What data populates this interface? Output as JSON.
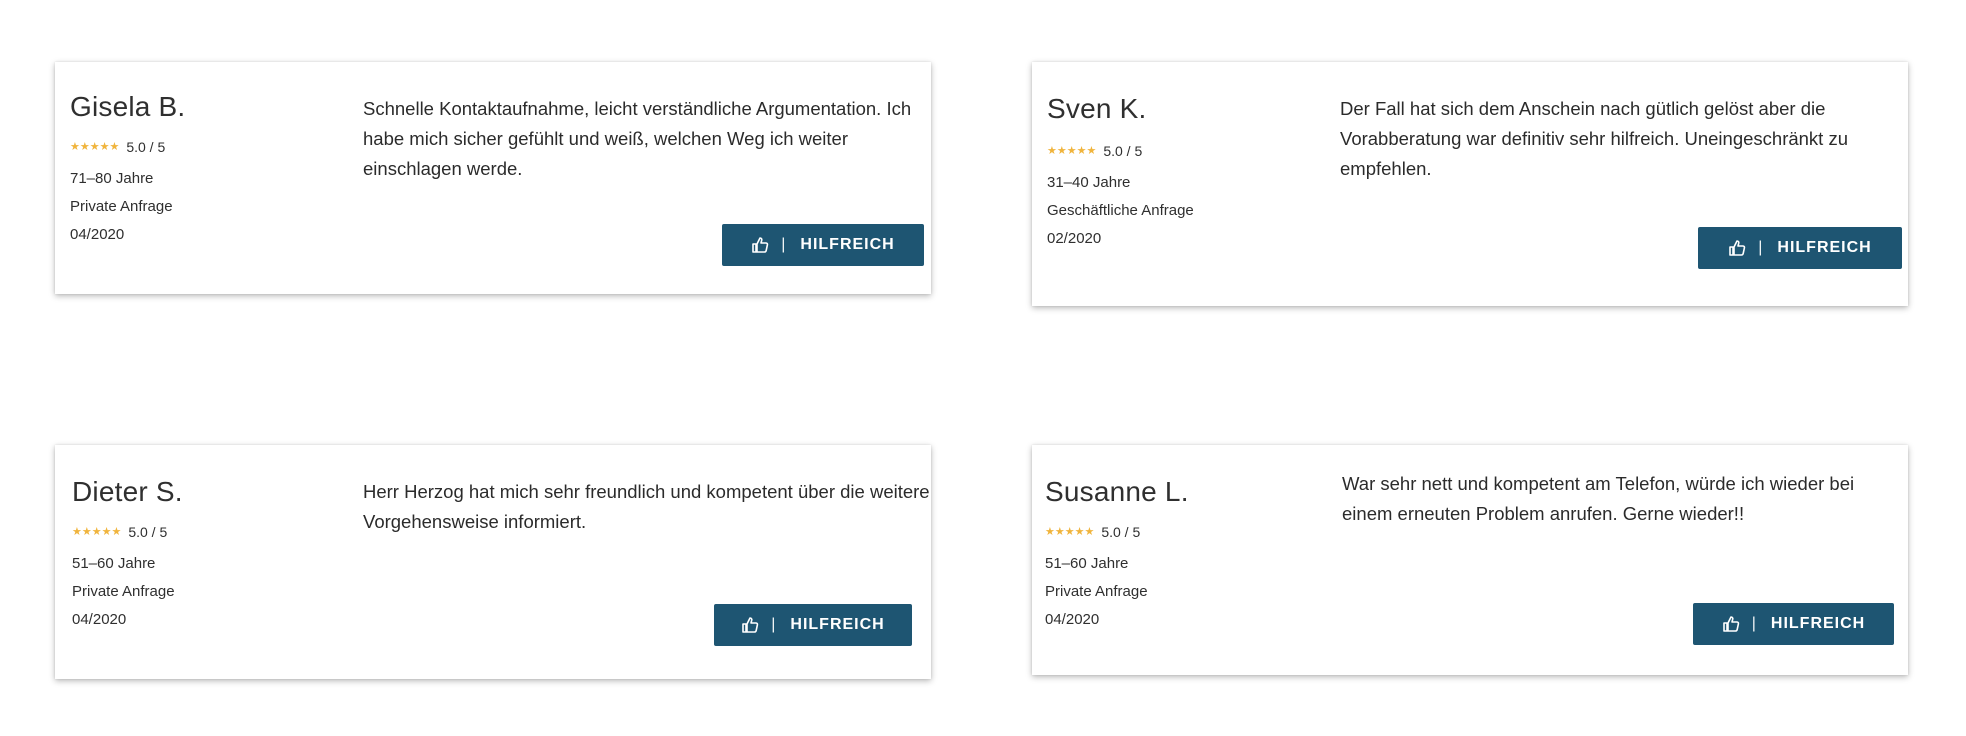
{
  "colors": {
    "button_bg": "#1e5572",
    "star": "#f0b43c",
    "text": "#2b2b2b"
  },
  "reviews": [
    {
      "name": "Gisela B.",
      "stars": "★★★★★",
      "rating": "5.0 / 5",
      "age": "71–80 Jahre",
      "type": "Private Anfrage",
      "date": "04/2020",
      "text": "Schnelle Kontaktaufnahme, leicht verständliche Argumentation. Ich habe mich sicher gefühlt und weiß, welchen Weg ich weiter einschlagen werde.",
      "button_label": "HILFREICH",
      "button_sep": "|",
      "button_icon": "thumbs-up-icon"
    },
    {
      "name": "Sven K.",
      "stars": "★★★★★",
      "rating": "5.0 / 5",
      "age": "31–40 Jahre",
      "type": "Geschäftliche Anfrage",
      "date": "02/2020",
      "text": "Der Fall hat sich dem Anschein nach gütlich gelöst aber die Vorabberatung war definitiv sehr hilfreich. Uneingeschränkt zu empfehlen.",
      "button_label": "HILFREICH",
      "button_sep": "|",
      "button_icon": "thumbs-up-icon"
    },
    {
      "name": "Dieter S.",
      "stars": "★★★★★",
      "rating": "5.0 / 5",
      "age": "51–60 Jahre",
      "type": "Private Anfrage",
      "date": "04/2020",
      "text": "Herr Herzog hat mich sehr freundlich und kompetent über die weitere Vorgehensweise informiert.",
      "button_label": "HILFREICH",
      "button_sep": "|",
      "button_icon": "thumbs-up-icon"
    },
    {
      "name": "Susanne L.",
      "stars": "★★★★★",
      "rating": "5.0 / 5",
      "age": "51–60 Jahre",
      "type": "Private Anfrage",
      "date": "04/2020",
      "text": "War sehr nett und kompetent am Telefon, würde ich wieder bei einem erneuten Problem anrufen. Gerne wieder!!",
      "button_label": "HILFREICH",
      "button_sep": "|",
      "button_icon": "thumbs-up-icon"
    }
  ]
}
